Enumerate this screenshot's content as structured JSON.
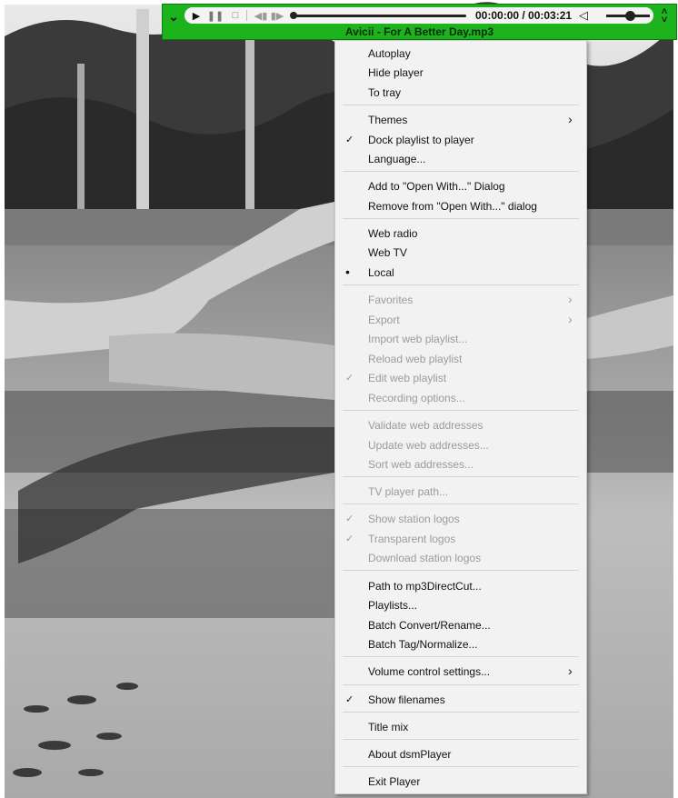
{
  "player": {
    "time": "00:00:00 / 00:03:21",
    "track_title": "Avicii - For A Better Day.mp3",
    "volume_level": 0.45,
    "position_fraction": 0
  },
  "menu": {
    "items": [
      {
        "label": "Autoplay",
        "enabled": true
      },
      {
        "label": "Hide player",
        "enabled": true
      },
      {
        "label": "To tray",
        "enabled": true
      },
      {
        "label": "Themes",
        "enabled": true,
        "submenu": true
      },
      {
        "label": "Dock playlist to player",
        "enabled": true,
        "checked": true
      },
      {
        "label": "Language...",
        "enabled": true
      },
      {
        "label": "Add to \"Open With...\" Dialog",
        "enabled": true
      },
      {
        "label": "Remove from \"Open With...\" dialog",
        "enabled": true
      },
      {
        "label": "Web radio",
        "enabled": true
      },
      {
        "label": "Web TV",
        "enabled": true
      },
      {
        "label": "Local",
        "enabled": true,
        "radio": true
      },
      {
        "label": "Favorites",
        "enabled": false,
        "submenu": true
      },
      {
        "label": "Export",
        "enabled": false,
        "submenu": true
      },
      {
        "label": "Import web playlist...",
        "enabled": false
      },
      {
        "label": "Reload web playlist",
        "enabled": false
      },
      {
        "label": "Edit web playlist",
        "enabled": false,
        "checked": true
      },
      {
        "label": "Recording options...",
        "enabled": false
      },
      {
        "label": "Validate web addresses",
        "enabled": false
      },
      {
        "label": "Update web addresses...",
        "enabled": false
      },
      {
        "label": "Sort web addresses...",
        "enabled": false
      },
      {
        "label": "TV player path...",
        "enabled": false
      },
      {
        "label": "Show station logos",
        "enabled": false,
        "checked": true
      },
      {
        "label": "Transparent logos",
        "enabled": false,
        "checked": true
      },
      {
        "label": "Download station logos",
        "enabled": false
      },
      {
        "label": "Path to mp3DirectCut...",
        "enabled": true
      },
      {
        "label": "Playlists...",
        "enabled": true
      },
      {
        "label": "Batch Convert/Rename...",
        "enabled": true
      },
      {
        "label": "Batch Tag/Normalize...",
        "enabled": true
      },
      {
        "label": "Volume control settings...",
        "enabled": true,
        "submenu": true
      },
      {
        "label": "Show filenames",
        "enabled": true,
        "checked": true
      },
      {
        "label": "Title mix",
        "enabled": true
      },
      {
        "label": "About dsmPlayer",
        "enabled": true
      },
      {
        "label": "Exit Player",
        "enabled": true
      }
    ]
  },
  "icons": {
    "collapse": "chevron-down-icon",
    "play": "play-icon",
    "pause": "pause-icon",
    "stop": "stop-icon",
    "previous": "previous-icon",
    "next": "next-icon",
    "mute": "speaker-icon",
    "expand": "chevron-updown-icon",
    "check": "check-icon",
    "radio": "bullet-icon",
    "submenu": "chevron-right-icon"
  }
}
